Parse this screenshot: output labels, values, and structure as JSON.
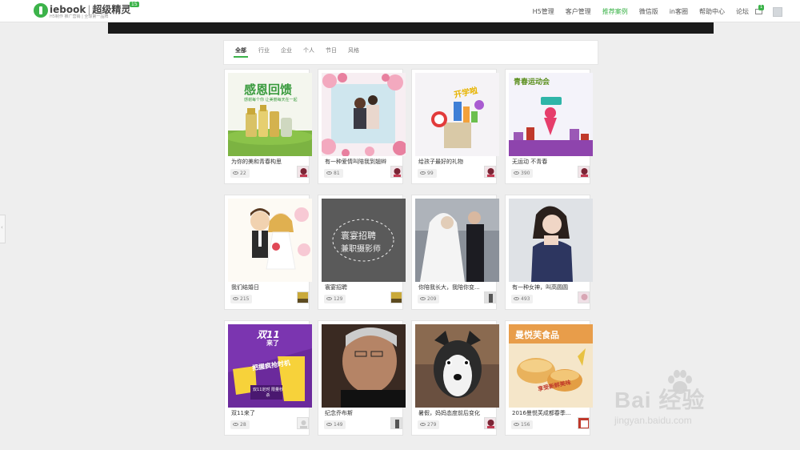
{
  "header": {
    "logo_name": "iebook",
    "logo_sub": "超级精灵",
    "logo_tagline": "H5制作 推广营销 | 全球第一品牌",
    "logo_badge": "15",
    "nav": [
      {
        "label": "H5管理",
        "active": false
      },
      {
        "label": "客户管理",
        "active": false
      },
      {
        "label": "推荐案例",
        "active": true
      },
      {
        "label": "微信版",
        "active": false
      },
      {
        "label": "in客圈",
        "active": false
      },
      {
        "label": "帮助中心",
        "active": false
      },
      {
        "label": "论坛",
        "active": false
      }
    ],
    "message_count": "1",
    "accent_color": "#3cb34a"
  },
  "filters": {
    "tabs": [
      "全部",
      "行业",
      "企业",
      "个人",
      "节日",
      "风格"
    ],
    "active_index": 0
  },
  "cards": [
    {
      "title": "为你的美和青春构思",
      "views": "22",
      "thumb_text": "感恩回馈",
      "thumb_sub": "感谢每个你 让美丽每天在一起"
    },
    {
      "title": "有一种爱情叫陪我到翘辫",
      "views": "81"
    },
    {
      "title": "给孩子最好的礼物",
      "views": "99",
      "thumb_text": "开学啦"
    },
    {
      "title": "无运动 不青春",
      "views": "390",
      "thumb_text": "青春运动会"
    },
    {
      "title": "我们结婚日",
      "views": "215"
    },
    {
      "title": "寰宴招聘",
      "views": "129",
      "thumb_text": "寰宴招聘",
      "thumb_sub": "兼职摄影师"
    },
    {
      "title": "你陪我长大，我陪你变...",
      "views": "209"
    },
    {
      "title": "有一种女神，叫高圆圆",
      "views": "493"
    },
    {
      "title": "双11来了",
      "views": "28",
      "thumb_text": "双11",
      "thumb_sub": "来了",
      "thumb_sub2": "把握疯抢时机",
      "thumb_sub3": "双11定时 限量秒杀"
    },
    {
      "title": "纪念乔布斯",
      "views": "149"
    },
    {
      "title": "暑假，妈妈态度前后变化",
      "views": "279"
    },
    {
      "title": "2016曼悦芙成都春季...",
      "views": "156",
      "thumb_text": "曼悦芙食品",
      "thumb_sub": "享受新鲜美味"
    }
  ],
  "watermark": {
    "brand": "Bai 经验",
    "url": "jingyan.baidu.com"
  }
}
